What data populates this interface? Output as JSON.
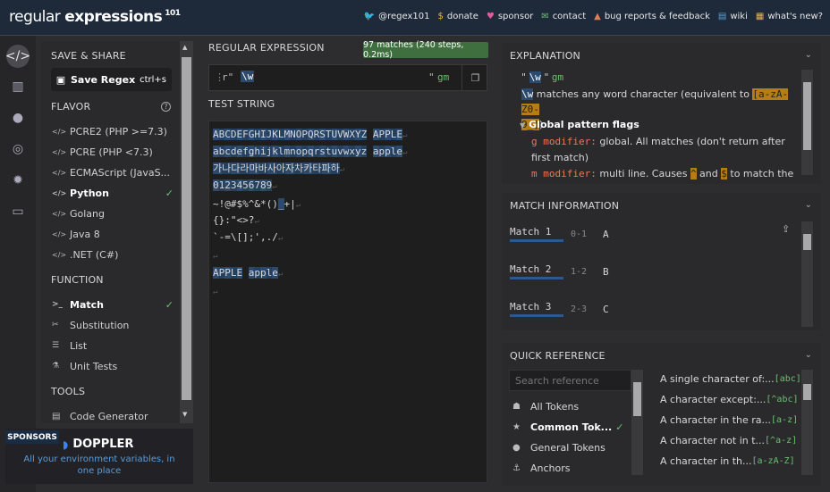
{
  "topbar": {
    "logo_main": "regular",
    "logo_bold": "expressions",
    "logo_ver": "101",
    "links": [
      {
        "icon": "twitter-icon",
        "glyph": "🐦",
        "label": "@regex101",
        "color": "#4ea1f3"
      },
      {
        "icon": "dollar-icon",
        "glyph": "$",
        "label": "donate",
        "color": "#e9b640"
      },
      {
        "icon": "heart-icon",
        "glyph": "♥",
        "label": "sponsor",
        "color": "#e35b9a"
      },
      {
        "icon": "mail-icon",
        "glyph": "✉",
        "label": "contact",
        "color": "#6cc070"
      },
      {
        "icon": "warning-icon",
        "glyph": "▲",
        "label": "bug reports & feedback",
        "color": "#e87a5a"
      },
      {
        "icon": "book-icon",
        "glyph": "▤",
        "label": "wiki",
        "color": "#5aa0d6"
      },
      {
        "icon": "news-icon",
        "glyph": "▦",
        "label": "what's new?",
        "color": "#e9b640"
      }
    ]
  },
  "sidebar": {
    "save_share": "SAVE & SHARE",
    "save_label": "Save Regex",
    "save_shortcut": "ctrl+s",
    "flavor_head": "FLAVOR",
    "flavors": [
      "PCRE2 (PHP >=7.3)",
      "PCRE (PHP <7.3)",
      "ECMAScript (JavaS...",
      "Python",
      "Golang",
      "Java 8",
      ".NET (C#)"
    ],
    "function_head": "FUNCTION",
    "functions": [
      "Match",
      "Substitution",
      "List",
      "Unit Tests"
    ],
    "tools_head": "TOOLS",
    "tools": [
      "Code Generator"
    ]
  },
  "sponsors": {
    "tag": "SPONSORS",
    "brand": "DOPPLER",
    "tagline1": "All your environment variables, in",
    "tagline2": "one place"
  },
  "regex": {
    "head": "REGULAR EXPRESSION",
    "badge": "97 matches (240 steps, 0.2ms)",
    "delim_prefix": "r\"",
    "pattern": "\\w",
    "delim_suffix": "\"",
    "flags": "gm"
  },
  "test": {
    "head": "TEST STRING",
    "lines": [
      "ABCDEFGHIJKLMNOPQRSTUVWXYZ APPLE",
      "abcdefghijklmnopqrstuvwxyz apple",
      "가나다라마바사아자차카타파하",
      "0123456789",
      "~!@#$%^&*()_+|",
      "{}:\"<>?",
      "`-=\\[];',./",
      "",
      "APPLE apple",
      ""
    ]
  },
  "explanation": {
    "head": "EXPLANATION",
    "line1_q": "\"",
    "line1_tok": "\\w",
    "line1_flags": "gm",
    "tok": "\\w",
    "desc": " matches any word character (equivalent to ",
    "cls1": "[a-zA-Z0-",
    "cls2": "9_]",
    "close": ")",
    "flags_head": "Global pattern flags",
    "g_mod": "g modifier:",
    "g_desc1": " global. All matches (don't return after",
    "g_desc2": "first match)",
    "m_mod": "m modifier:",
    "m_desc": " multi line. Causes ",
    "caret": "^",
    "and": " and ",
    "dollar": "$",
    "m_tail": " to match the"
  },
  "matchinfo": {
    "head": "MATCH INFORMATION",
    "rows": [
      {
        "label": "Match 1",
        "range": "0-1",
        "value": "A"
      },
      {
        "label": "Match 2",
        "range": "1-2",
        "value": "B"
      },
      {
        "label": "Match 3",
        "range": "2-3",
        "value": "C"
      }
    ]
  },
  "quickref": {
    "head": "QUICK REFERENCE",
    "search_placeholder": "Search reference",
    "categories": [
      "All Tokens",
      "Common Tok...",
      "General Tokens",
      "Anchors"
    ],
    "refs": [
      {
        "desc": "A single character of:...",
        "token": "[abc]"
      },
      {
        "desc": "A character except:...",
        "token": "[^abc]"
      },
      {
        "desc": "A character in the ra...",
        "token": "[a-z]"
      },
      {
        "desc": "A character not in t...",
        "token": "[^a-z]"
      },
      {
        "desc": "A character in th...",
        "token": "[a-zA-Z]"
      }
    ]
  }
}
